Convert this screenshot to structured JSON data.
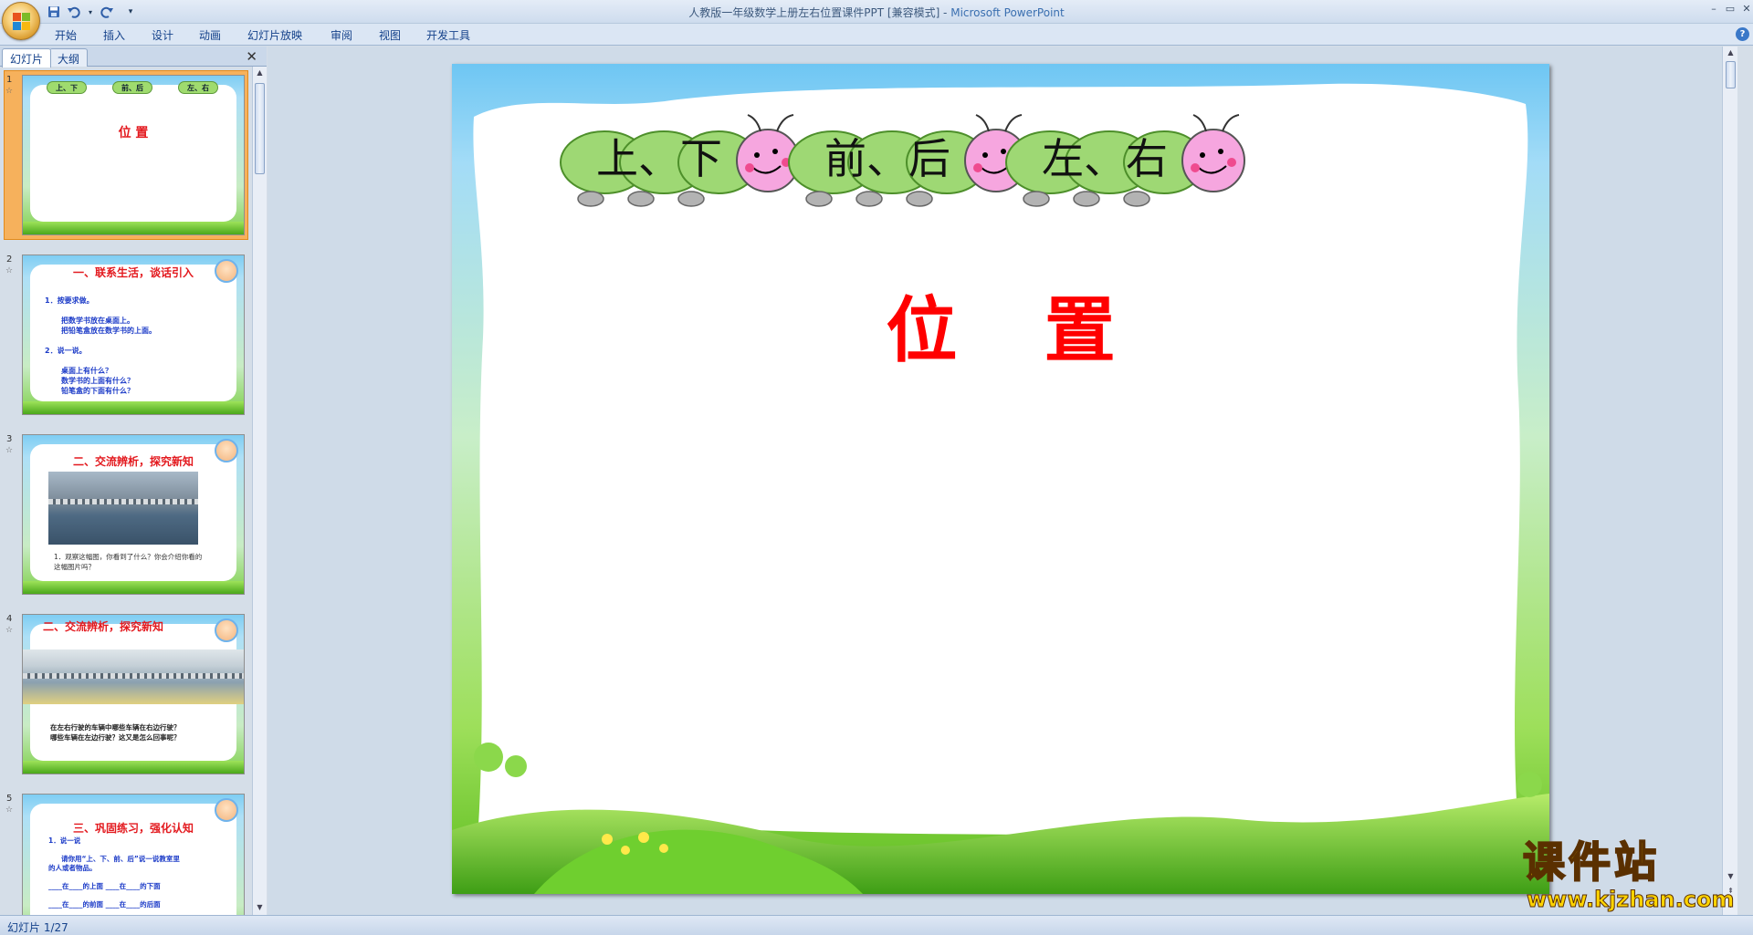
{
  "window": {
    "title": "人教版一年级数学上册左右位置课件PPT [兼容模式] - ",
    "app_name": "Microsoft PowerPoint",
    "buttons": {
      "minimize": "–",
      "restore": "▭",
      "close": "✕"
    }
  },
  "quick_access": {
    "save_icon": "save-icon",
    "undo_icon": "undo-icon",
    "redo_icon": "redo-icon",
    "customize": "▾"
  },
  "ribbon": {
    "tabs": [
      "开始",
      "插入",
      "设计",
      "动画",
      "幻灯片放映",
      "审阅",
      "视图",
      "开发工具"
    ],
    "help": "?"
  },
  "left_pane": {
    "tabs": [
      "幻灯片",
      "大纲"
    ],
    "close": "✕",
    "slides": [
      {
        "number": "1",
        "star": "☆",
        "title": "位 置",
        "cats": [
          "上、下",
          "前、后",
          "左、右"
        ]
      },
      {
        "number": "2",
        "star": "☆",
        "title": "一、联系生活，谈话引入",
        "lines": [
          "1．按要求做。",
          "",
          "把数学书放在桌面上。",
          "把铅笔盒放在数学书的上面。",
          "",
          "2．说一说。",
          "",
          "桌面上有什么？",
          "数学书的上面有什么？",
          "铅笔盒的下面有什么？"
        ]
      },
      {
        "number": "3",
        "star": "☆",
        "title": "二、交流辨析，探究新知",
        "caption": [
          "1．观察这幅图，你看到了什么？你会介绍你看的",
          "这幅图片吗？"
        ]
      },
      {
        "number": "4",
        "star": "☆",
        "title": "二、交流辨析，探究新知",
        "caption": [
          "在左右行驶的车辆中哪些车辆在右边行驶？",
          "哪些车辆在左边行驶？这又是怎么回事呢？"
        ]
      },
      {
        "number": "5",
        "star": "☆",
        "title": "三、巩固练习，强化认知",
        "lines": [
          "1．说一说",
          "",
          "请你用“上、下、前、后”说一说教室里",
          "的人或者物品。",
          "",
          "____在____的上面        ____在____的下面",
          "",
          "____在____的前面        ____在____的后面"
        ]
      }
    ]
  },
  "slide": {
    "title": "位 置",
    "caterpillars": [
      "上、下",
      "前、后",
      "左、右"
    ]
  },
  "status": {
    "text": "幻灯片 1/27"
  },
  "watermark": {
    "title": "课件站",
    "url": "www.kjzhan.com"
  }
}
